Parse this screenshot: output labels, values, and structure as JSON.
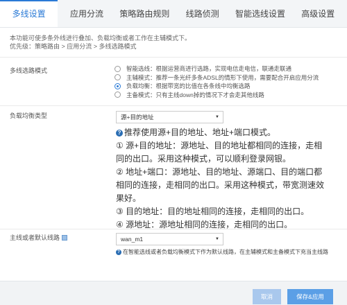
{
  "tabs": [
    {
      "label": "多线设置",
      "active": true
    },
    {
      "label": "应用分流",
      "active": false
    },
    {
      "label": "策略路由规则",
      "active": false
    },
    {
      "label": "线路侦测",
      "active": false
    },
    {
      "label": "智能选线设置",
      "active": false
    },
    {
      "label": "高级设置",
      "active": false
    }
  ],
  "description": {
    "line1": "本功能可使多条外线进行叠加、负载均衡或者工作在主辅模式下。",
    "line2": "优先级：策略路由 > 应用分流 > 多线选路模式"
  },
  "mode": {
    "label": "多线选路模式",
    "options": [
      "智能选线：根据运营商进行选路，实现电信走电信，联通走联通",
      "主辅模式：推荐一条光纤多条ADSL的情形下使用，需要配合开启应用分流",
      "负载均衡：根据带宽的比值在各条线中均衡选路",
      "主备模式：只有主线down掉的情况下才会走其他线路"
    ],
    "selected_index": 2
  },
  "balance": {
    "label": "负载均衡类型",
    "select_value": "源+目的地址",
    "help_lines": [
      "推荐使用源+目的地址、地址+端口模式。",
      "① 源+目的地址：源地址、目的地址都相同的连接，走相",
      "同的出口。采用这种模式，可以顺利登录网银。",
      "② 地址+端口：源地址、目的地址、源端口、目的端口都",
      "相同的连接，走相同的出口。采用这种模式，带宽测速效",
      "果好。",
      "③ 目的地址：目的地址相同的连接，走相同的出口。",
      "④ 源地址：源地址相同的连接，走相同的出口。"
    ]
  },
  "default_line": {
    "label": "主线或者默认线路",
    "select_value": "wan_m1",
    "note": "在智能选线或者负载均衡模式下作为默认线路，在主辅模式和主备模式下充当主线路"
  },
  "footer": {
    "cancel_label": "取消",
    "save_label": "保存&应用"
  },
  "colors": {
    "accent": "#2a7ad6",
    "save_button": "#5b9fe6",
    "cancel_button": "#a9c8ed"
  }
}
